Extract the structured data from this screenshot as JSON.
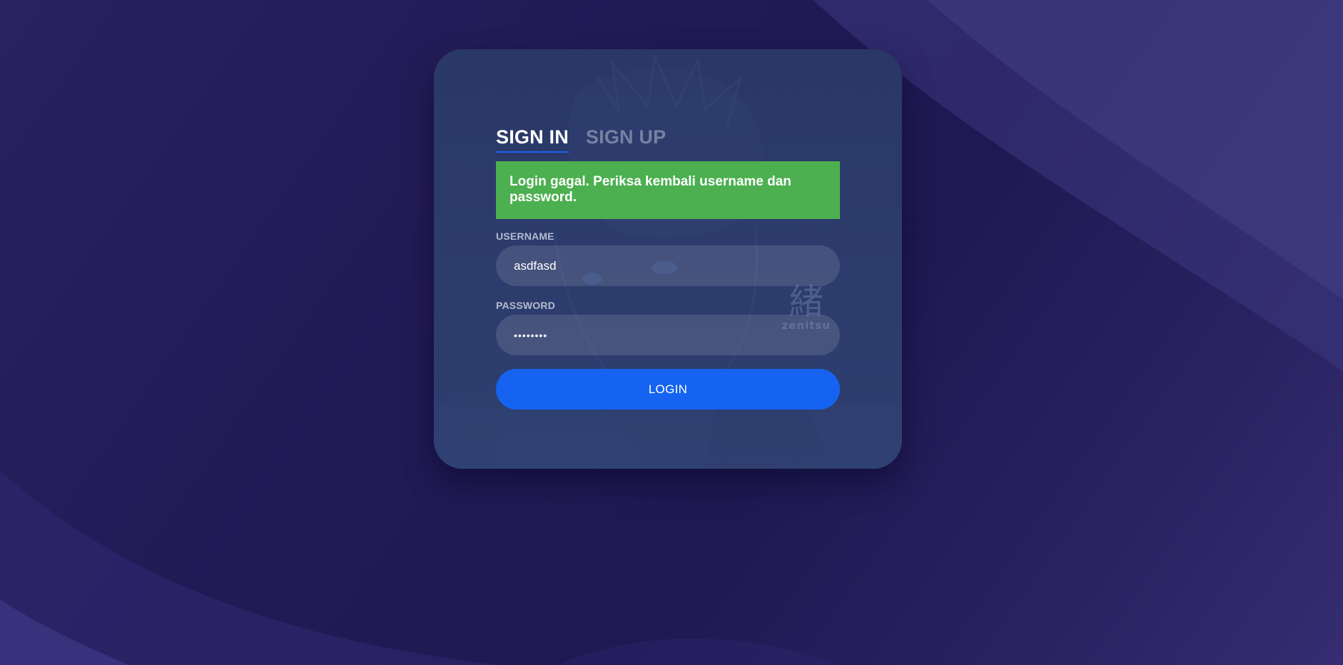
{
  "tabs": {
    "sign_in": "SIGN IN",
    "sign_up": "SIGN UP",
    "active": "sign_in"
  },
  "alert": {
    "message": "Login gagal. Periksa kembali username dan password.",
    "color": "#4caf50"
  },
  "form": {
    "username_label": "USERNAME",
    "username_value": "asdfasd",
    "password_label": "PASSWORD",
    "password_value": "••••••••",
    "login_label": "LOGIN"
  },
  "watermark": {
    "kanji": "緒",
    "text": "zenitsu"
  },
  "colors": {
    "accent": "#1563f0",
    "alert": "#4caf50",
    "card": "#2a3766",
    "background": "#221a55"
  }
}
